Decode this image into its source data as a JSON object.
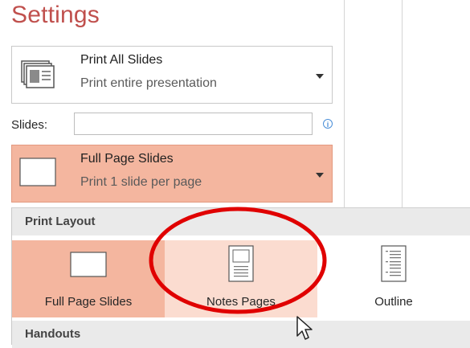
{
  "settings_title": "Settings",
  "print_range": {
    "line1": "Print All Slides",
    "line2": "Print entire presentation",
    "icon": "slides-stack-icon"
  },
  "slides": {
    "label": "Slides:",
    "value": "",
    "info_icon": "info-icon",
    "info_glyph": "i"
  },
  "layout_select": {
    "line1": "Full Page Slides",
    "line2": "Print 1 slide per page",
    "icon": "slide-thumbnail-icon"
  },
  "dropdown": {
    "print_layout_header": "Print Layout",
    "items": [
      {
        "label": "Full Page Slides",
        "icon": "full-page-slides-icon",
        "state": "selected"
      },
      {
        "label": "Notes Pages",
        "icon": "notes-pages-icon",
        "state": "hover"
      },
      {
        "label": "Outline",
        "icon": "outline-icon",
        "state": "normal"
      }
    ],
    "handouts_header": "Handouts"
  },
  "colors": {
    "title": "#c0504d",
    "selected_bg": "#f4b69f",
    "hover_bg": "#fbdcd0",
    "annotation_circle": "#e00000"
  }
}
